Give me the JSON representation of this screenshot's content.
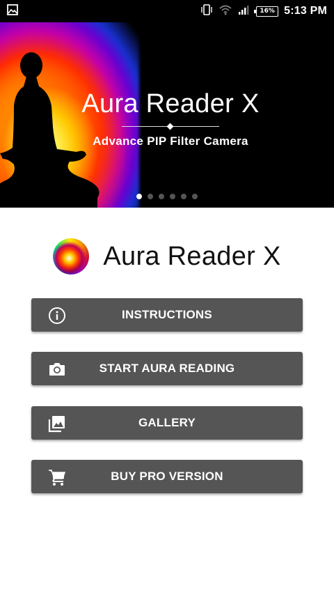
{
  "status_bar": {
    "time": "5:13 PM",
    "battery": "16%",
    "icons": [
      "image-icon",
      "vibrate-icon",
      "wifi-icon",
      "signal-icon",
      "battery-icon"
    ]
  },
  "banner": {
    "title": "Aura Reader X",
    "subtitle": "Advance PIP Filter Camera",
    "page_count": 6,
    "active_page": 1
  },
  "app": {
    "name": "Aura Reader X"
  },
  "menu": [
    {
      "label": "INSTRUCTIONS",
      "icon": "info-icon"
    },
    {
      "label": "START AURA READING",
      "icon": "camera-icon"
    },
    {
      "label": "GALLERY",
      "icon": "gallery-icon"
    },
    {
      "label": "BUY PRO VERSION",
      "icon": "cart-icon"
    }
  ],
  "colors": {
    "button_bg": "#555555",
    "button_text": "#ffffff",
    "status_bar_bg": "#000000"
  }
}
